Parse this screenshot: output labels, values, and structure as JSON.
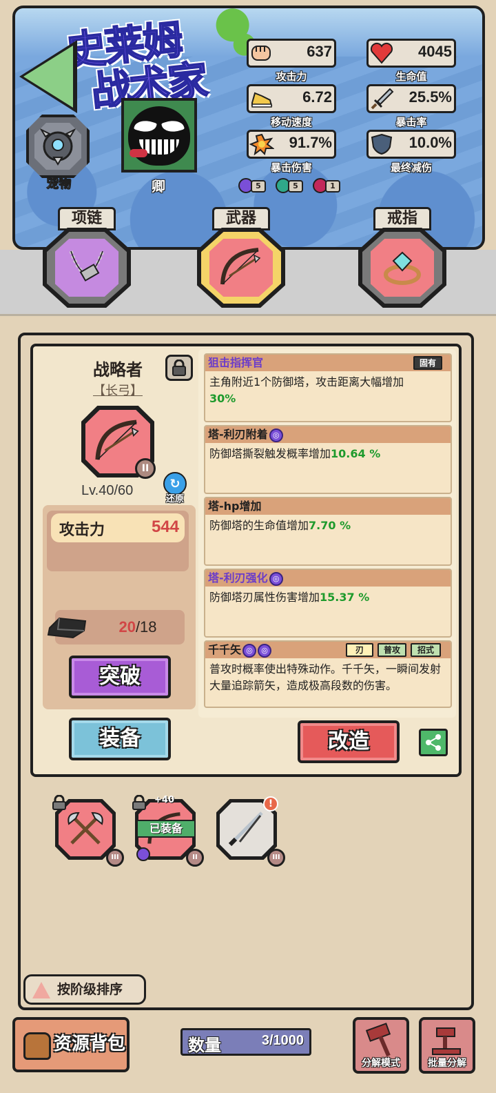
{
  "hero": {
    "title_line1": "史莱姆",
    "title_line2": "战术家",
    "pet_label": "宠物",
    "avatar_label": "卿"
  },
  "stats": [
    {
      "icon": "fist-icon",
      "value": "637",
      "label": "攻击力"
    },
    {
      "icon": "heart-icon",
      "value": "4045",
      "label": "生命值"
    },
    {
      "icon": "shoe-icon",
      "value": "6.72",
      "label": "移动速度"
    },
    {
      "icon": "sword-icon",
      "value": "25.5%",
      "label": "暴击率"
    },
    {
      "icon": "explosion-icon",
      "value": "91.7%",
      "label": "暴击伤害"
    },
    {
      "icon": "shield-icon",
      "value": "10.0%",
      "label": "最终减伤"
    }
  ],
  "badges": [
    {
      "color": "#7a4fd8",
      "count": "5"
    },
    {
      "color": "#2fa88a",
      "count": "5"
    },
    {
      "color": "#c2285a",
      "count": "1"
    }
  ],
  "slots": [
    {
      "label": "项链",
      "active": false
    },
    {
      "label": "武器",
      "active": true
    },
    {
      "label": "戒指",
      "active": false
    }
  ],
  "item": {
    "name": "战略者",
    "type": "【长弓】",
    "tier": "II",
    "level": "Lv.40/60",
    "restore_label": "还原",
    "attack_label": "攻击力",
    "attack_value": "544",
    "material_have": "20",
    "material_need": "/18"
  },
  "buttons": {
    "breakthrough": "突破",
    "equip": "装备",
    "modify": "改造"
  },
  "affixes": [
    {
      "title": "狙击指挥官",
      "purple": true,
      "tag": "固有",
      "text": "主角附近1个防御塔，攻击距离大幅增加",
      "value": "30%",
      "newline": true
    },
    {
      "title": "塔-利刃附着",
      "purple": false,
      "rune": true,
      "text": "防御塔撕裂触发概率增加",
      "value": "10.64 %"
    },
    {
      "title": "塔-hp增加",
      "purple": false,
      "text": "防御塔的生命值增加",
      "value": "7.70 %"
    },
    {
      "title": "塔-利刃强化",
      "purple": true,
      "rune": true,
      "text": "防御塔刃属性伤害增加",
      "value": "15.37 %"
    },
    {
      "title": "千千矢",
      "purple": false,
      "rune2": true,
      "chips": [
        "刃",
        "普攻",
        "招式"
      ],
      "text": "普攻时概率使出特殊动作。千千矢，一瞬间发射大量追踪箭矢，造成极高段数的伤害。"
    }
  ],
  "inventory": [
    {
      "icon": "axe-icon",
      "tier": "III",
      "bg": "#f17f85",
      "locked": true,
      "equipped": false,
      "alert": false,
      "plus": ""
    },
    {
      "icon": "bow-icon",
      "tier": "II",
      "bg": "#f17f85",
      "locked": true,
      "equipped": true,
      "equipped_label": "已装备",
      "alert": false,
      "plus": "+40"
    },
    {
      "icon": "katana-icon",
      "tier": "III",
      "bg": "#e4e0da",
      "locked": false,
      "equipped": false,
      "alert": true,
      "plus": ""
    }
  ],
  "sort_label": "按阶级排序",
  "bottom": {
    "bag_label": "资源背包",
    "count_label": "数量",
    "count_value": "3/1000",
    "decompose_mode": "分解模式",
    "batch_decompose": "批量分解"
  }
}
